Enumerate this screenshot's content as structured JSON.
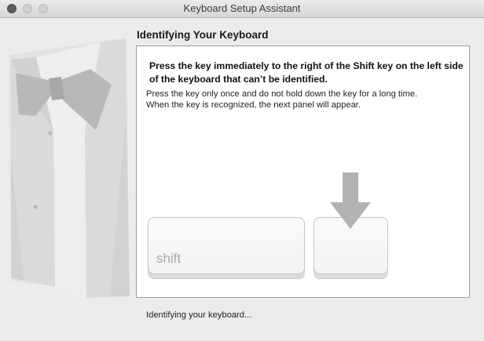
{
  "window": {
    "title": "Keyboard Setup Assistant"
  },
  "page": {
    "heading": "Identifying Your Keyboard",
    "instruction": "Press the key immediately to the right of the Shift key on the left side of the keyboard that can’t be identified.",
    "note_line1": "Press the key only once and do not hold down the key for a long time.",
    "note_line2": "When the key is recognized, the next panel will appear."
  },
  "keyboard": {
    "shift_label": "shift"
  },
  "status": {
    "text": "Identifying your keyboard..."
  },
  "colors": {
    "window_bg": "#ececec",
    "panel_bg": "#ffffff",
    "arrow": "#b2b2b2"
  },
  "icons": {
    "illustration": "tuxedo-illustration",
    "pointer": "down-arrow-icon"
  }
}
